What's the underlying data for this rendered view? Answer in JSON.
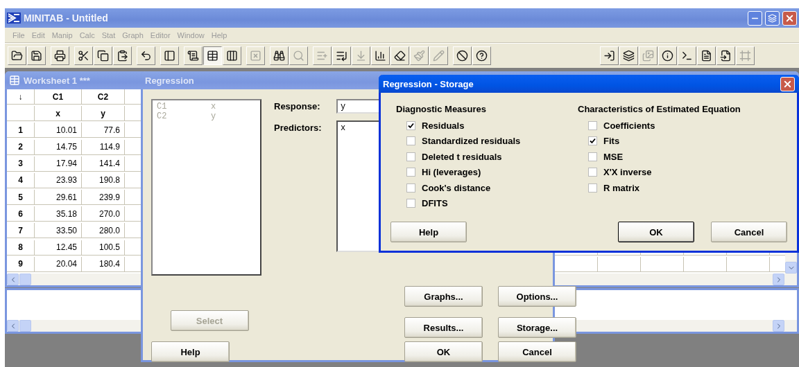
{
  "window": {
    "title": "MINITAB - Untitled"
  },
  "menu_bar": [
    "File",
    "Edit",
    "Manip",
    "Calc",
    "Stat",
    "Graph",
    "Editor",
    "Window",
    "Help"
  ],
  "worksheet": {
    "title": "Worksheet 1 ***",
    "active": false,
    "corner": "↓",
    "columns": [
      {
        "id": "C1",
        "name": "x"
      },
      {
        "id": "C2",
        "name": "y"
      }
    ],
    "rows": [
      {
        "number": "1",
        "cells": [
          "10.01",
          "77.6"
        ]
      },
      {
        "number": "2",
        "cells": [
          "14.75",
          "114.9"
        ]
      },
      {
        "number": "3",
        "cells": [
          "17.94",
          "141.4"
        ]
      },
      {
        "number": "4",
        "cells": [
          "23.93",
          "190.8"
        ]
      },
      {
        "number": "5",
        "cells": [
          "29.61",
          "239.9"
        ]
      },
      {
        "number": "6",
        "cells": [
          "35.18",
          "270.0"
        ]
      },
      {
        "number": "7",
        "cells": [
          "33.50",
          "280.0"
        ]
      },
      {
        "number": "8",
        "cells": [
          "12.45",
          "100.5"
        ]
      },
      {
        "number": "9",
        "cells": [
          "20.04",
          "180.4"
        ]
      }
    ]
  },
  "regression_dialog": {
    "title": "Regression",
    "active": false,
    "variables": [
      {
        "column": "C1",
        "name": "x"
      },
      {
        "column": "C2",
        "name": "y"
      }
    ],
    "response_label": "Response:",
    "response": "y",
    "predictors_label": "Predictors:",
    "predictors": "x",
    "select_button": {
      "label": "Select",
      "disabled": true
    },
    "option_buttons": [
      "Graphs...",
      "Options...",
      "Results...",
      "Storage..."
    ],
    "footer_buttons": [
      "Help",
      "OK",
      "Cancel"
    ]
  },
  "storage_dialog": {
    "title": "Regression - Storage",
    "active": true,
    "groups": [
      {
        "title": "Diagnostic Measures",
        "options": [
          {
            "label": "Residuals",
            "checked": true
          },
          {
            "label": "Standardized residuals",
            "checked": false
          },
          {
            "label": "Deleted t residuals",
            "checked": false
          },
          {
            "label": "Hi (leverages)",
            "checked": false
          },
          {
            "label": "Cook's distance",
            "checked": false
          },
          {
            "label": "DFITS",
            "checked": false
          }
        ]
      },
      {
        "title": "Characteristics of Estimated Equation",
        "options": [
          {
            "label": "Coefficients",
            "checked": false
          },
          {
            "label": "Fits",
            "checked": true
          },
          {
            "label": "MSE",
            "checked": false
          },
          {
            "label": "X'X inverse",
            "checked": false
          },
          {
            "label": "R matrix",
            "checked": false
          }
        ]
      }
    ],
    "buttons": [
      {
        "label": "Help",
        "default": false
      },
      {
        "label": "OK",
        "default": true
      },
      {
        "label": "Cancel",
        "default": false
      }
    ]
  }
}
